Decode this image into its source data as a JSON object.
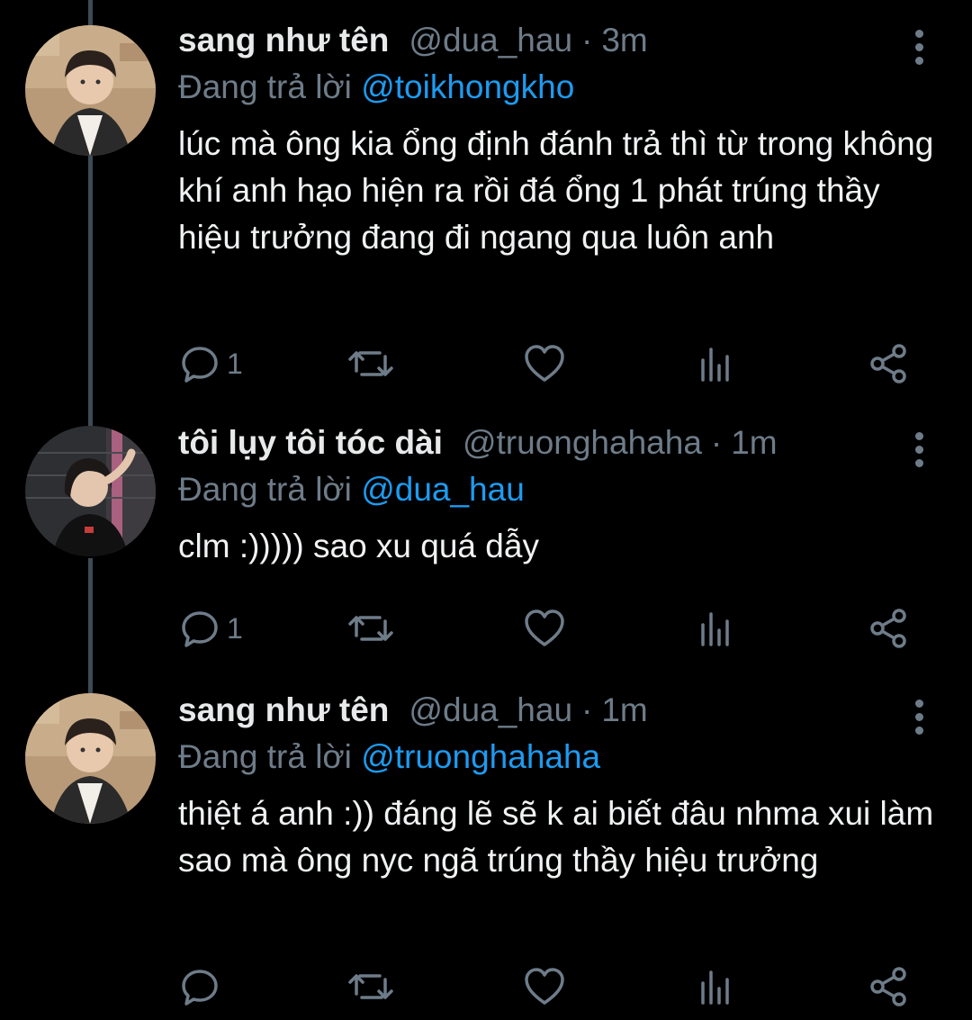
{
  "tweets": [
    {
      "name": "sang như tên",
      "handle": "@dua_hau",
      "dot": "·",
      "time": "3m",
      "reply_prefix": "Đang trả lời ",
      "reply_to": "@toikhongkho",
      "text": "lúc mà ông kia ổng định đánh trả thì từ trong không khí anh hạo hiện ra rồi đá ổng 1 phát trúng thầy hiệu trưởng đang đi ngang qua luôn anh",
      "reply_count": "1"
    },
    {
      "name": "tôi lụy tôi tóc dài",
      "handle": "@truonghahaha",
      "dot": "·",
      "time": "1m",
      "reply_prefix": "Đang trả lời ",
      "reply_to": "@dua_hau",
      "text": "clm :))))) sao xu quá dẫy",
      "reply_count": "1"
    },
    {
      "name": "sang như tên",
      "handle": "@dua_hau",
      "dot": "·",
      "time": "1m",
      "reply_prefix": "Đang trả lời ",
      "reply_to": "@truonghahaha",
      "text": "thiệt á anh :)) đáng lẽ sẽ k ai biết đâu nhma xui làm sao mà ông nyc ngã trúng thầy hiệu trưởng",
      "reply_count": ""
    }
  ],
  "icons": {
    "reply": "reply-icon",
    "retweet": "retweet-icon",
    "like": "heart-icon",
    "stats": "stats-icon",
    "share": "share-icon",
    "more": "more-vertical-icon"
  },
  "colors": {
    "background": "#000000",
    "text": "#e7e9ea",
    "muted": "#6e7c89",
    "mention": "#1d9bf0",
    "thread_line": "#3d4a55"
  }
}
